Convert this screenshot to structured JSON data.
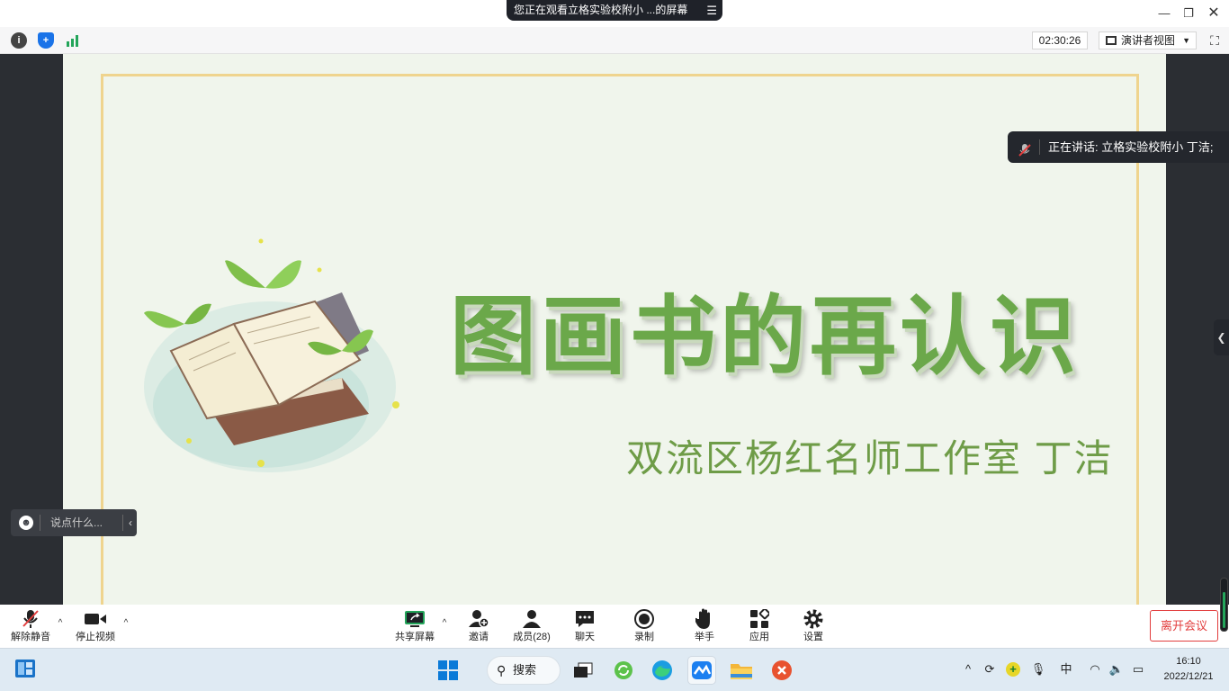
{
  "window": {
    "share_banner": "您正在观看立格实验校附小  ...的屏幕",
    "share_menu_icon": "menu-lines-icon",
    "controls": [
      "minimize-icon",
      "restore-icon",
      "close-icon"
    ]
  },
  "infobar": {
    "icons": [
      "info-icon",
      "shield-icon",
      "signal-icon"
    ],
    "timer": "02:30:26",
    "view_label": "演讲者视图",
    "fullscreen_icon": "fullscreen-icon"
  },
  "slide": {
    "title": "图画书的再认识",
    "subtitle": "双流区杨红名师工作室  丁洁",
    "frame_color": "#efd48e",
    "title_color": "#6ba84a",
    "subtitle_color": "#6e9c47"
  },
  "speaker": {
    "label": "正在讲话: 立格实验校附小  丁洁;"
  },
  "chat": {
    "placeholder": "说点什么..."
  },
  "toolbar": {
    "unmute": "解除静音",
    "stop_video": "停止视频",
    "share_screen": "共享屏幕",
    "invite": "邀请",
    "members": "成员(28)",
    "chat": "聊天",
    "record": "录制",
    "raise_hand": "举手",
    "apps": "应用",
    "settings": "设置",
    "leave": "离开会议",
    "leave_color": "#e23d3d"
  },
  "taskbar": {
    "search": "搜索",
    "ime": "中",
    "time": "16:10",
    "date": "2022/12/21"
  }
}
